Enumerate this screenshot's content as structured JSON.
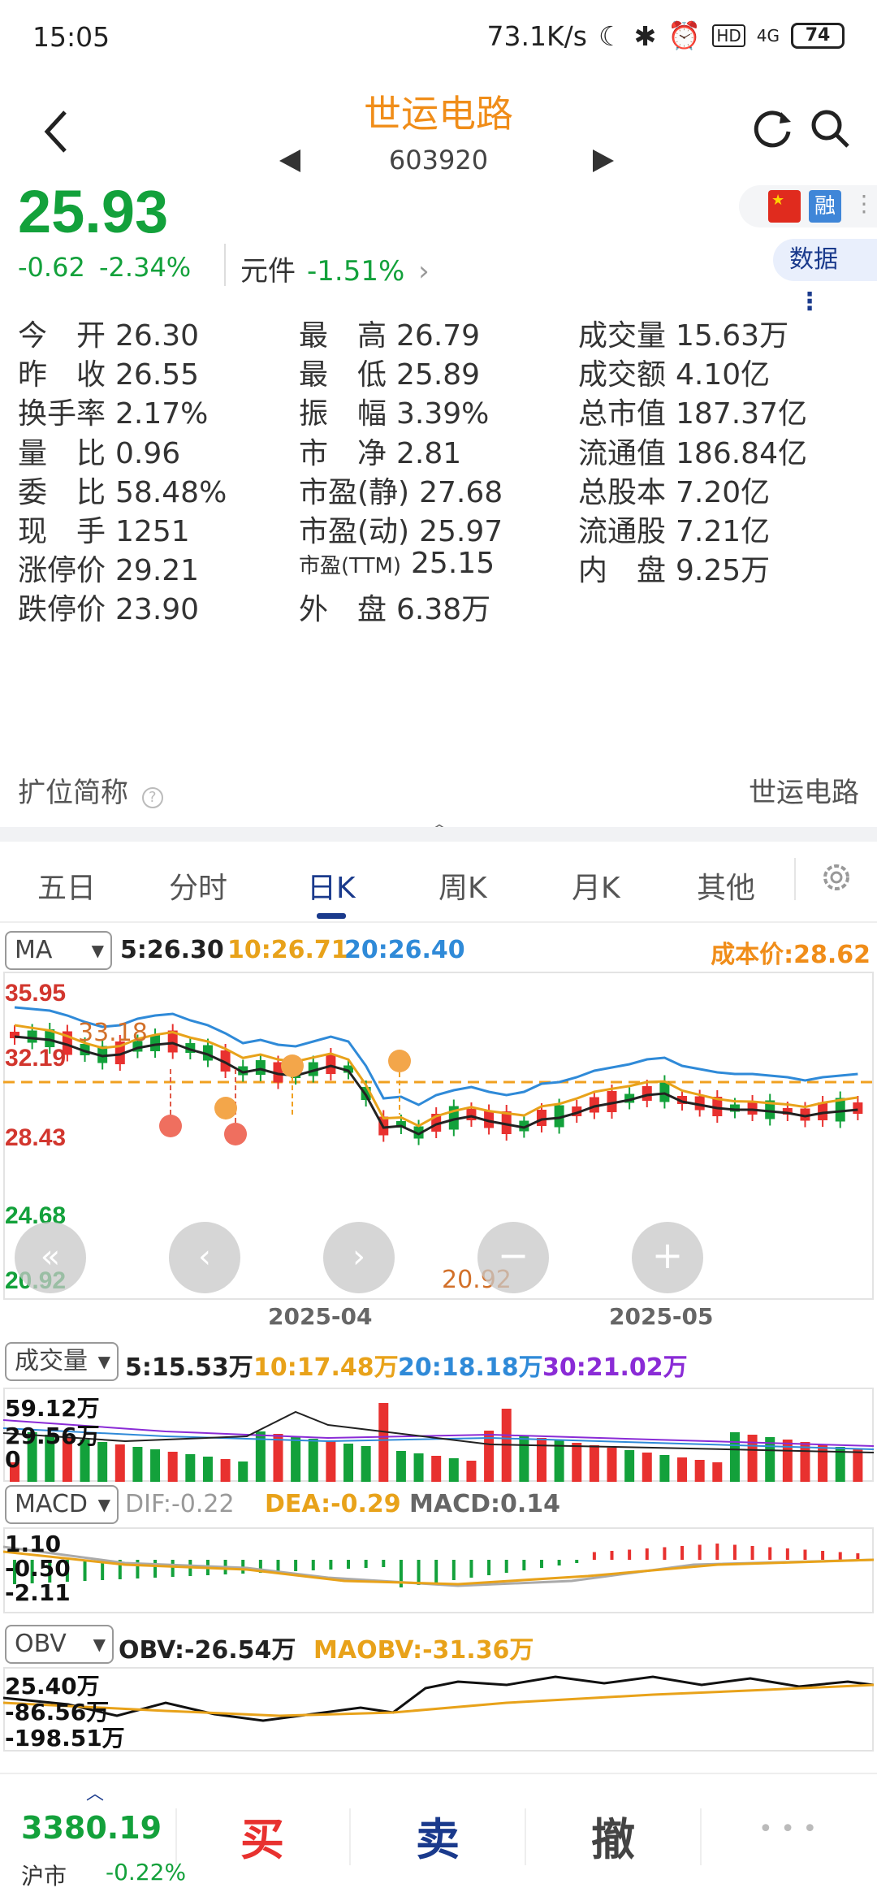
{
  "status_bar": {
    "time": "15:05",
    "net_speed": "73.1K/s",
    "signal": "4G",
    "battery": "74"
  },
  "header": {
    "name": "世运电路",
    "code": "603920"
  },
  "quote": {
    "price": "25.93",
    "change": "-0.62",
    "change_pct": "-2.34%",
    "sector_name": "元件",
    "sector_pct": "-1.51%",
    "flag_label": "融",
    "data_button": "数据"
  },
  "fields": [
    {
      "label": "今　开",
      "value": "26.30"
    },
    {
      "label": "最　高",
      "value": "26.79"
    },
    {
      "label": "成交量",
      "value": "15.63万"
    },
    {
      "label": "昨　收",
      "value": "26.55"
    },
    {
      "label": "最　低",
      "value": "25.89"
    },
    {
      "label": "成交额",
      "value": "4.10亿"
    },
    {
      "label": "换手率",
      "value": "2.17%"
    },
    {
      "label": "振　幅",
      "value": "3.39%"
    },
    {
      "label": "总市值",
      "value": "187.37亿"
    },
    {
      "label": "量　比",
      "value": "0.96"
    },
    {
      "label": "市　净",
      "value": "2.81"
    },
    {
      "label": "流通值",
      "value": "186.84亿"
    },
    {
      "label": "委　比",
      "value": "58.48%"
    },
    {
      "label": "市盈(静)",
      "value": "27.68"
    },
    {
      "label": "总股本",
      "value": "7.20亿"
    },
    {
      "label": "现　手",
      "value": "1251"
    },
    {
      "label": "市盈(动)",
      "value": "25.97"
    },
    {
      "label": "流通股",
      "value": "7.21亿"
    },
    {
      "label": "涨停价",
      "value": "29.21"
    },
    {
      "label": "市盈(TTM)",
      "value": "25.15"
    },
    {
      "label": "内　盘",
      "value": "9.25万"
    },
    {
      "label": "跌停价",
      "value": "23.90"
    },
    {
      "label": "外　盘",
      "value": "6.38万"
    }
  ],
  "short_name_label": "扩位简称",
  "short_name_value": "世运电路",
  "tabs": [
    "五日",
    "分时",
    "日K",
    "周K",
    "月K",
    "其他"
  ],
  "kline": {
    "selector": "MA",
    "ma5": "5:26.30",
    "ma10": "10:26.71",
    "ma20": "20:26.40",
    "cost": "成本价:28.62",
    "y_labels": [
      "35.95",
      "32.19",
      "28.43",
      "24.68",
      "20.92"
    ],
    "high_mark": "33.18",
    "low_mark": "20.92",
    "x_labels": [
      "2025-04",
      "2025-05"
    ],
    "marker_b": "B",
    "marker_t": "T"
  },
  "volume": {
    "selector": "成交量",
    "v5": "5:15.53万",
    "v10": "10:17.48万",
    "v20": "20:18.18万",
    "v30": "30:21.02万",
    "y_labels": [
      "59.12万",
      "29.56万",
      "0"
    ]
  },
  "macd": {
    "selector": "MACD",
    "dif": "DIF:-0.22",
    "dea": "DEA:-0.29",
    "macd": "MACD:0.14",
    "y_labels": [
      "1.10",
      "-0.50",
      "-2.11"
    ]
  },
  "obv": {
    "selector": "OBV",
    "obv": "OBV:-26.54万",
    "maobv": "MAOBV:-31.36万",
    "y_labels": [
      "25.40万",
      "-86.56万",
      "-198.51万"
    ]
  },
  "bottom": {
    "index_value": "3380.19",
    "index_name": "沪市",
    "index_change": "-0.22%",
    "buy": "买",
    "sell": "卖",
    "cancel": "撤",
    "more": "• • •"
  },
  "colors": {
    "up": "#e8312f",
    "down": "#13a13b",
    "ma5": "#222222",
    "ma10": "#e8a21a",
    "ma20": "#2f8ad8",
    "ma30": "#8a2bd6",
    "accent": "#f08d19",
    "brand": "#1a3a8c"
  }
}
